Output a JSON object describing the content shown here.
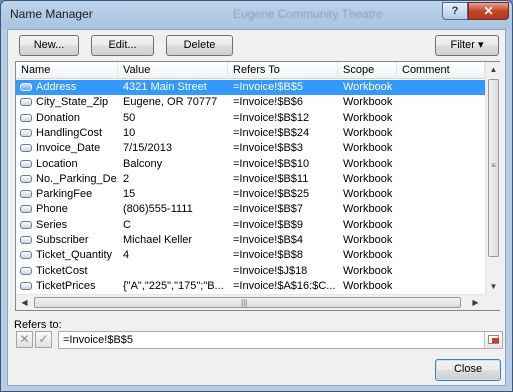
{
  "window": {
    "title": "Name Manager",
    "background_title": "Eugene Community Theatre",
    "help_label": "?",
    "close_label": "✕"
  },
  "toolbar": {
    "new_label": "New...",
    "edit_label": "Edit...",
    "delete_label": "Delete",
    "filter_label": "Filter ▾"
  },
  "table": {
    "columns": [
      "Name",
      "Value",
      "Refers To",
      "Scope",
      "Comment"
    ],
    "rows": [
      {
        "name": "Address",
        "value": "4321 Main Street",
        "refers_to": "=Invoice!$B$5",
        "scope": "Workbook",
        "comment": "",
        "selected": true
      },
      {
        "name": "City_State_Zip",
        "value": "Eugene, OR 70777",
        "refers_to": "=Invoice!$B$6",
        "scope": "Workbook",
        "comment": ""
      },
      {
        "name": "Donation",
        "value": "50",
        "refers_to": "=Invoice!$B$12",
        "scope": "Workbook",
        "comment": ""
      },
      {
        "name": "HandlingCost",
        "value": "10",
        "refers_to": "=Invoice!$B$24",
        "scope": "Workbook",
        "comment": ""
      },
      {
        "name": "Invoice_Date",
        "value": "7/15/2013",
        "refers_to": "=Invoice!$B$3",
        "scope": "Workbook",
        "comment": ""
      },
      {
        "name": "Location",
        "value": "Balcony",
        "refers_to": "=Invoice!$B$10",
        "scope": "Workbook",
        "comment": ""
      },
      {
        "name": "No._Parking_De...",
        "value": "2",
        "refers_to": "=Invoice!$B$11",
        "scope": "Workbook",
        "comment": ""
      },
      {
        "name": "ParkingFee",
        "value": "15",
        "refers_to": "=Invoice!$B$25",
        "scope": "Workbook",
        "comment": ""
      },
      {
        "name": "Phone",
        "value": "(806)555-1111",
        "refers_to": "=Invoice!$B$7",
        "scope": "Workbook",
        "comment": ""
      },
      {
        "name": "Series",
        "value": "C",
        "refers_to": "=Invoice!$B$9",
        "scope": "Workbook",
        "comment": ""
      },
      {
        "name": "Subscriber",
        "value": "Michael Keller",
        "refers_to": "=Invoice!$B$4",
        "scope": "Workbook",
        "comment": ""
      },
      {
        "name": "Ticket_Quantity",
        "value": "4",
        "refers_to": "=Invoice!$B$8",
        "scope": "Workbook",
        "comment": ""
      },
      {
        "name": "TicketCost",
        "value": "",
        "refers_to": "=Invoice!$J$18",
        "scope": "Workbook",
        "comment": ""
      },
      {
        "name": "TicketPrices",
        "value": "{\"A\",\"225\",\"175\";\"B...",
        "refers_to": "=Invoice!$A$16:$C...",
        "scope": "Workbook",
        "comment": ""
      }
    ]
  },
  "refers_to": {
    "label": "Refers to:",
    "value": "=Invoice!$B$5",
    "cancel_label": "✕",
    "confirm_label": "✓"
  },
  "footer": {
    "close_label": "Close"
  },
  "icons": [
    "name-icon",
    "help-icon",
    "close-icon",
    "collapse-dialog-icon",
    "cancel-icon",
    "confirm-icon"
  ],
  "colors": {
    "selection": "#3399ff",
    "title_bar": "#a9c4e0",
    "close_button": "#c2452a"
  }
}
